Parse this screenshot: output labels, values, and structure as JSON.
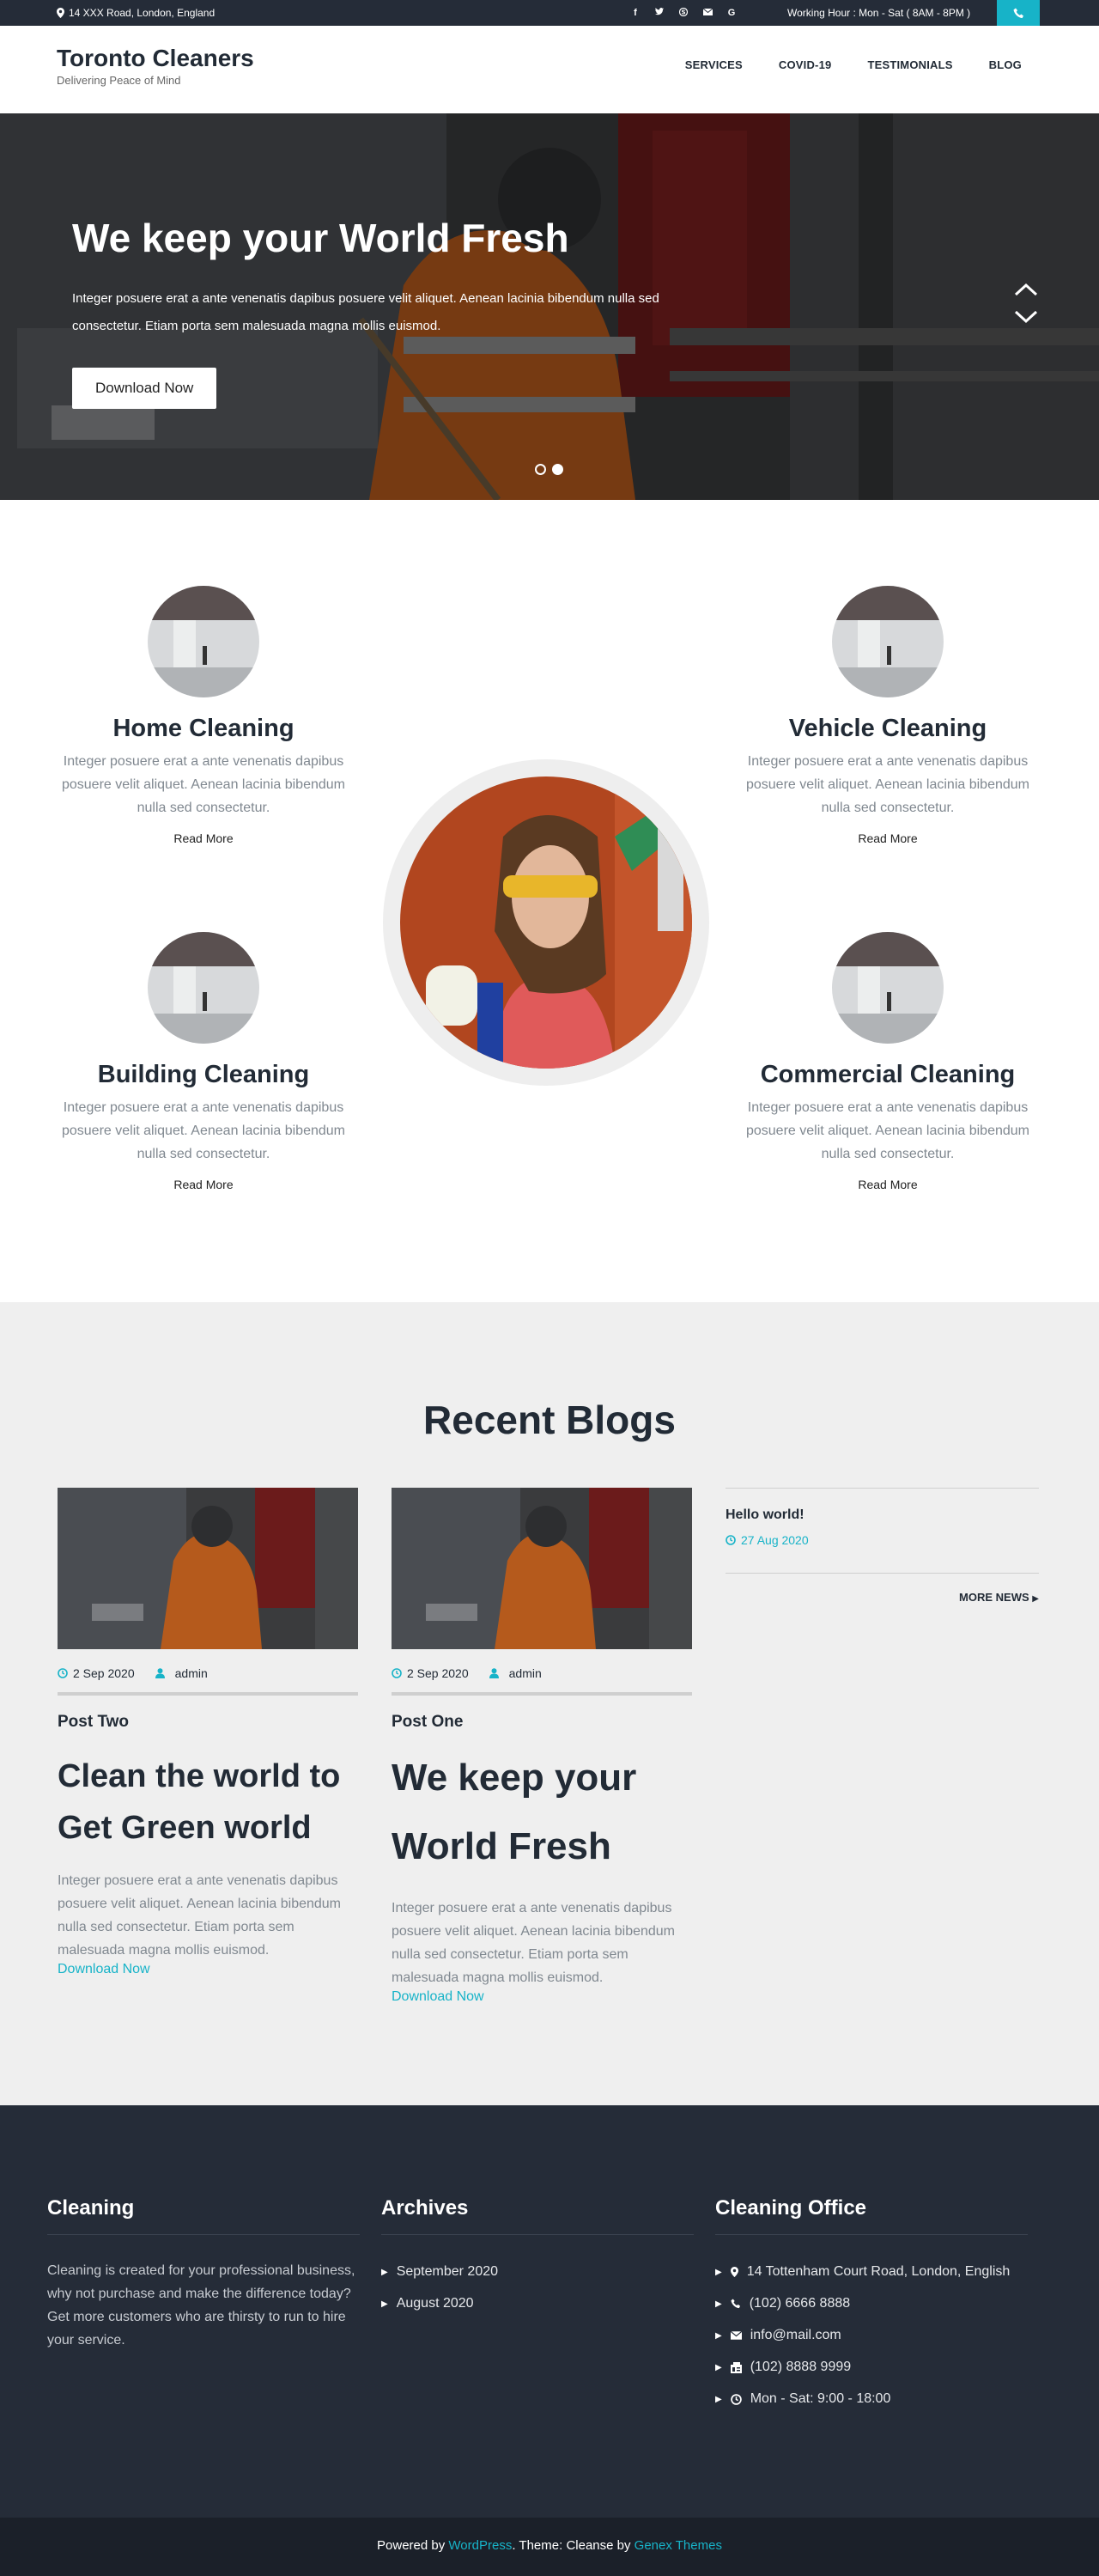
{
  "topbar": {
    "address": "14 XXX Road, London, England",
    "socials": [
      "facebook-icon",
      "twitter-icon",
      "skype-icon",
      "mail-icon",
      "google-icon"
    ],
    "hours": "Working Hour : Mon - Sat ( 8AM - 8PM )",
    "accent": "#17b3c8"
  },
  "header": {
    "site_name": "Toronto Cleaners",
    "tagline": "Delivering Peace of Mind",
    "nav": [
      "SERVICES",
      "COVID-19",
      "TESTIMONIALS",
      "BLOG"
    ]
  },
  "hero": {
    "title": "We keep your World Fresh",
    "text": "Integer posuere erat a ante venenatis dapibus posuere velit aliquet. Aenean lacinia bibendum nulla sed consectetur. Etiam porta sem malesuada magna mollis euismod.",
    "button": "Download Now"
  },
  "services": [
    {
      "title": "Home Cleaning",
      "text": "Integer posuere erat a ante venenatis dapibus posuere velit aliquet. Aenean lacinia bibendum nulla sed consectetur.",
      "more": "Read More"
    },
    {
      "title": "Vehicle Cleaning",
      "text": "Integer posuere erat a ante venenatis dapibus posuere velit aliquet. Aenean lacinia bibendum nulla sed consectetur.",
      "more": "Read More"
    },
    {
      "title": "Building Cleaning",
      "text": "Integer posuere erat a ante venenatis dapibus posuere velit aliquet. Aenean lacinia bibendum nulla sed consectetur.",
      "more": "Read More"
    },
    {
      "title": "Commercial Cleaning",
      "text": "Integer posuere erat a ante venenatis dapibus posuere velit aliquet. Aenean lacinia bibendum nulla sed consectetur.",
      "more": "Read More"
    }
  ],
  "blogs": {
    "heading": "Recent Blogs",
    "posts": [
      {
        "date": "2 Sep 2020",
        "author": "admin",
        "name": "Post Two",
        "title": "Clean the world to Get Green world",
        "excerpt": "Integer posuere erat a ante venenatis dapibus posuere velit aliquet. Aenean lacinia bibendum nulla sed consectetur. Etiam porta sem malesuada magna mollis euismod.",
        "link": "Download Now"
      },
      {
        "date": "2 Sep 2020",
        "author": "admin",
        "name": "Post One",
        "title": "We keep your World Fresh",
        "excerpt": "Integer posuere erat a ante venenatis dapibus posuere velit aliquet. Aenean lacinia bibendum nulla sed consectetur. Etiam porta sem malesuada magna mollis euismod.",
        "link": "Download Now"
      }
    ],
    "sidebar": {
      "title": "Hello world!",
      "date": "27 Aug 2020",
      "more": "MORE NEWS"
    }
  },
  "footer": {
    "about": {
      "heading": "Cleaning",
      "text": "Cleaning is created for your professional business, why not purchase and make the difference today? Get more customers who are thirsty to run to hire your service."
    },
    "archives": {
      "heading": "Archives",
      "items": [
        "September 2020",
        "August 2020"
      ]
    },
    "office": {
      "heading": "Cleaning Office",
      "items": [
        "14 Tottenham Court Road, London, English",
        "(102) 6666 8888",
        "info@mail.com",
        "(102) 8888 9999",
        "Mon - Sat: 9:00 - 18:00"
      ]
    },
    "credits": {
      "powered": "Powered by",
      "wp": "WordPress",
      "theme": "Theme: Cleanse by",
      "author": "Genex Themes"
    }
  }
}
